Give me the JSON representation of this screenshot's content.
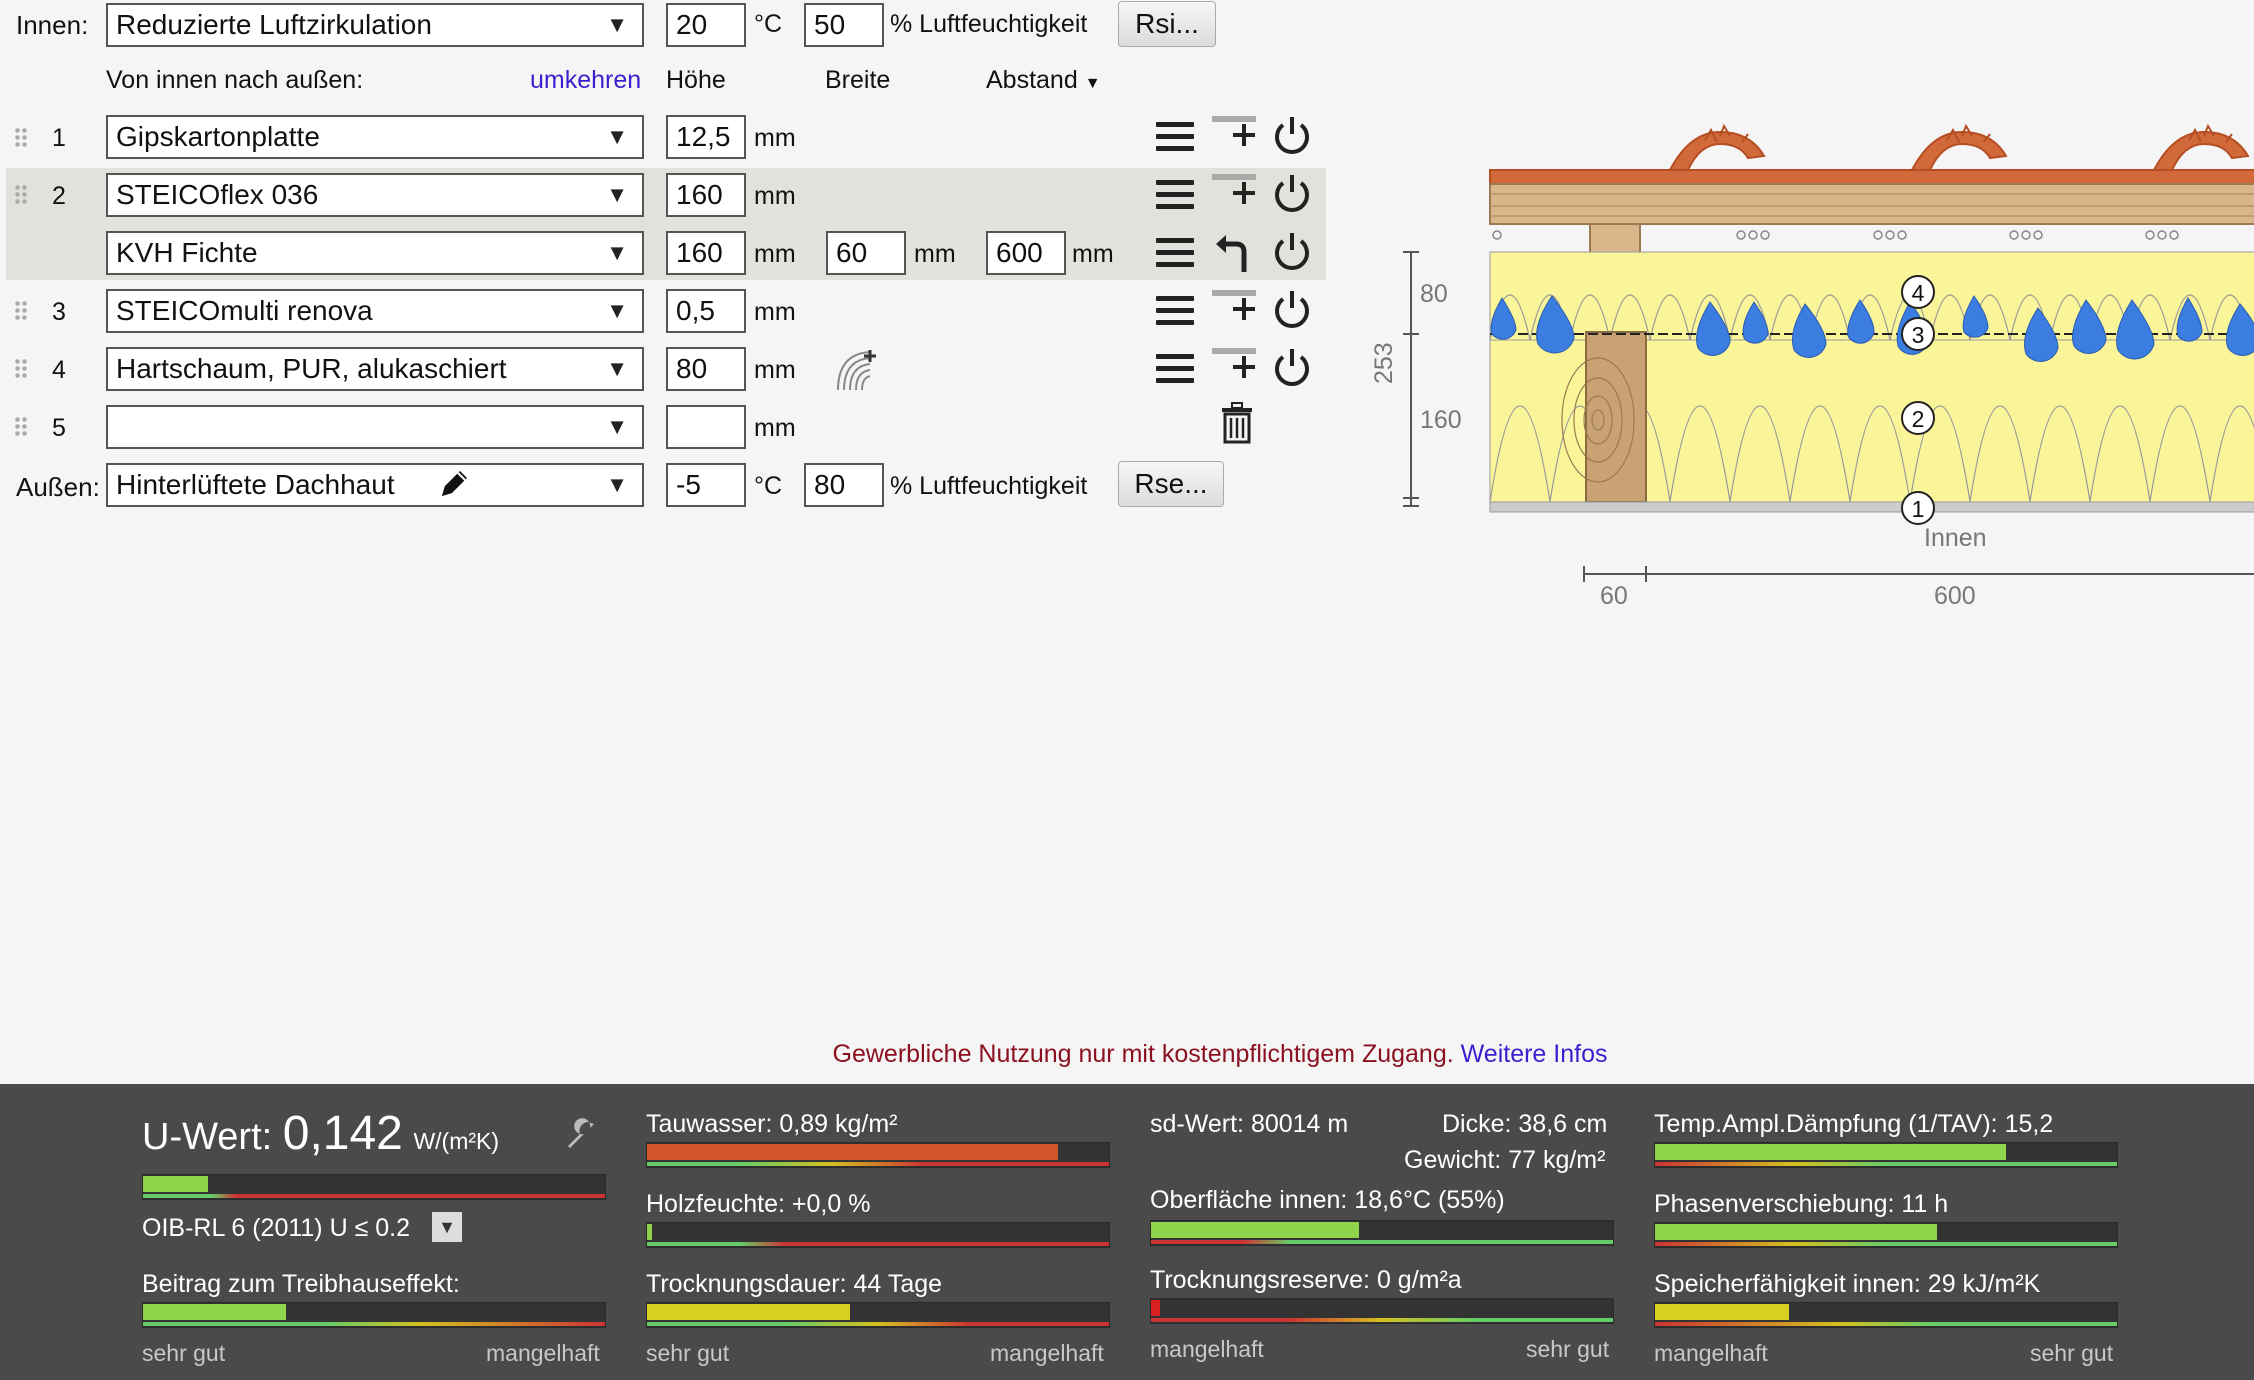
{
  "inside": {
    "label": "Innen:",
    "preset": "Reduzierte Luftzirkulation",
    "temp": "20",
    "temp_unit": "°C",
    "humidity": "50",
    "humidity_unit": "% Luftfeuchtigkeit",
    "rsi_button": "Rsi..."
  },
  "header": {
    "direction": "Von innen nach außen:",
    "reverse_link": "umkehren",
    "col_height": "Höhe",
    "col_width": "Breite",
    "col_spacing": "Abstand"
  },
  "layers": [
    {
      "num": "1",
      "material": "Gipskartonplatte",
      "thickness": "12,5",
      "unit": "mm"
    },
    {
      "num": "2",
      "material": "STEICOflex 036",
      "thickness": "160",
      "unit": "mm"
    },
    {
      "num": "",
      "material": "KVH Fichte",
      "thickness": "160",
      "unit": "mm",
      "width": "60",
      "width_unit": "mm",
      "spacing": "600",
      "spacing_unit": "mm"
    },
    {
      "num": "3",
      "material": "STEICOmulti renova",
      "thickness": "0,5",
      "unit": "mm"
    },
    {
      "num": "4",
      "material": "Hartschaum, PUR, alukaschiert",
      "thickness": "80",
      "unit": "mm"
    },
    {
      "num": "5",
      "material": "",
      "thickness": "",
      "unit": "mm"
    }
  ],
  "outside": {
    "label": "Außen:",
    "preset": "Hinterlüftete Dachhaut",
    "temp": "-5",
    "temp_unit": "°C",
    "humidity": "80",
    "humidity_unit": "% Luftfeuchtigkeit",
    "rse_button": "Rse..."
  },
  "diagram": {
    "dim_total": "253",
    "dim_top": "80",
    "dim_bottom": "160",
    "markers": [
      "4",
      "3",
      "2",
      "1"
    ],
    "inside_label": "Innen",
    "dim_width": "60",
    "dim_spacing": "600"
  },
  "notice": {
    "text": "Gewerbliche Nutzung nur mit kostenpflichtigem Zugang.",
    "link": "Weitere Infos"
  },
  "results": {
    "uwert_label": "U-Wert:",
    "uwert_value": "0,142",
    "uwert_unit": "W/(m²K)",
    "uwert_norm": "OIB-RL 6 (2011) U ≤ 0.2",
    "uwert_fill": 0.14,
    "greenhouse_label": "Beitrag zum Treibhauseffekt:",
    "greenhouse_fill": 0.31,
    "col1_left": "sehr gut",
    "col1_right": "mangelhaft",
    "condensate": "Tauwasser: 0,89 kg/m²",
    "condensate_fill": 0.89,
    "wood_moisture": "Holzfeuchte: +0,0 %",
    "wood_moisture_fill": 0.01,
    "drying": "Trocknungsdauer: 44 Tage",
    "drying_fill": 0.44,
    "col2_left": "sehr gut",
    "col2_right": "mangelhaft",
    "sd_value": "sd-Wert: 80014 m",
    "thickness": "Dicke: 38,6 cm",
    "weight": "Gewicht: 77 kg/m²",
    "surface_inside": "Oberfläche innen: 18,6°C (55%)",
    "surface_fill": 0.45,
    "drying_reserve": "Trocknungsreserve: 0 g/m²a",
    "drying_reserve_fill": 0.02,
    "col3_left": "mangelhaft",
    "col3_right": "sehr gut",
    "damping": "Temp.Ampl.Dämpfung (1/TAV): 15,2",
    "damping_fill": 0.76,
    "phase_shift": "Phasenverschiebung: 11 h",
    "phase_fill": 0.61,
    "heat_capacity": "Speicherfähigkeit innen: 29 kJ/m²K",
    "heat_fill": 0.29,
    "col4_left": "mangelhaft",
    "col4_right": "sehr gut"
  },
  "colors": {
    "link": "#3a1fd0",
    "notice": "#8b1020",
    "bar_green": "#8fd44a",
    "bar_orange": "#d2552a",
    "bar_yellow": "#d8d020",
    "insulation": "#fbf59a"
  }
}
